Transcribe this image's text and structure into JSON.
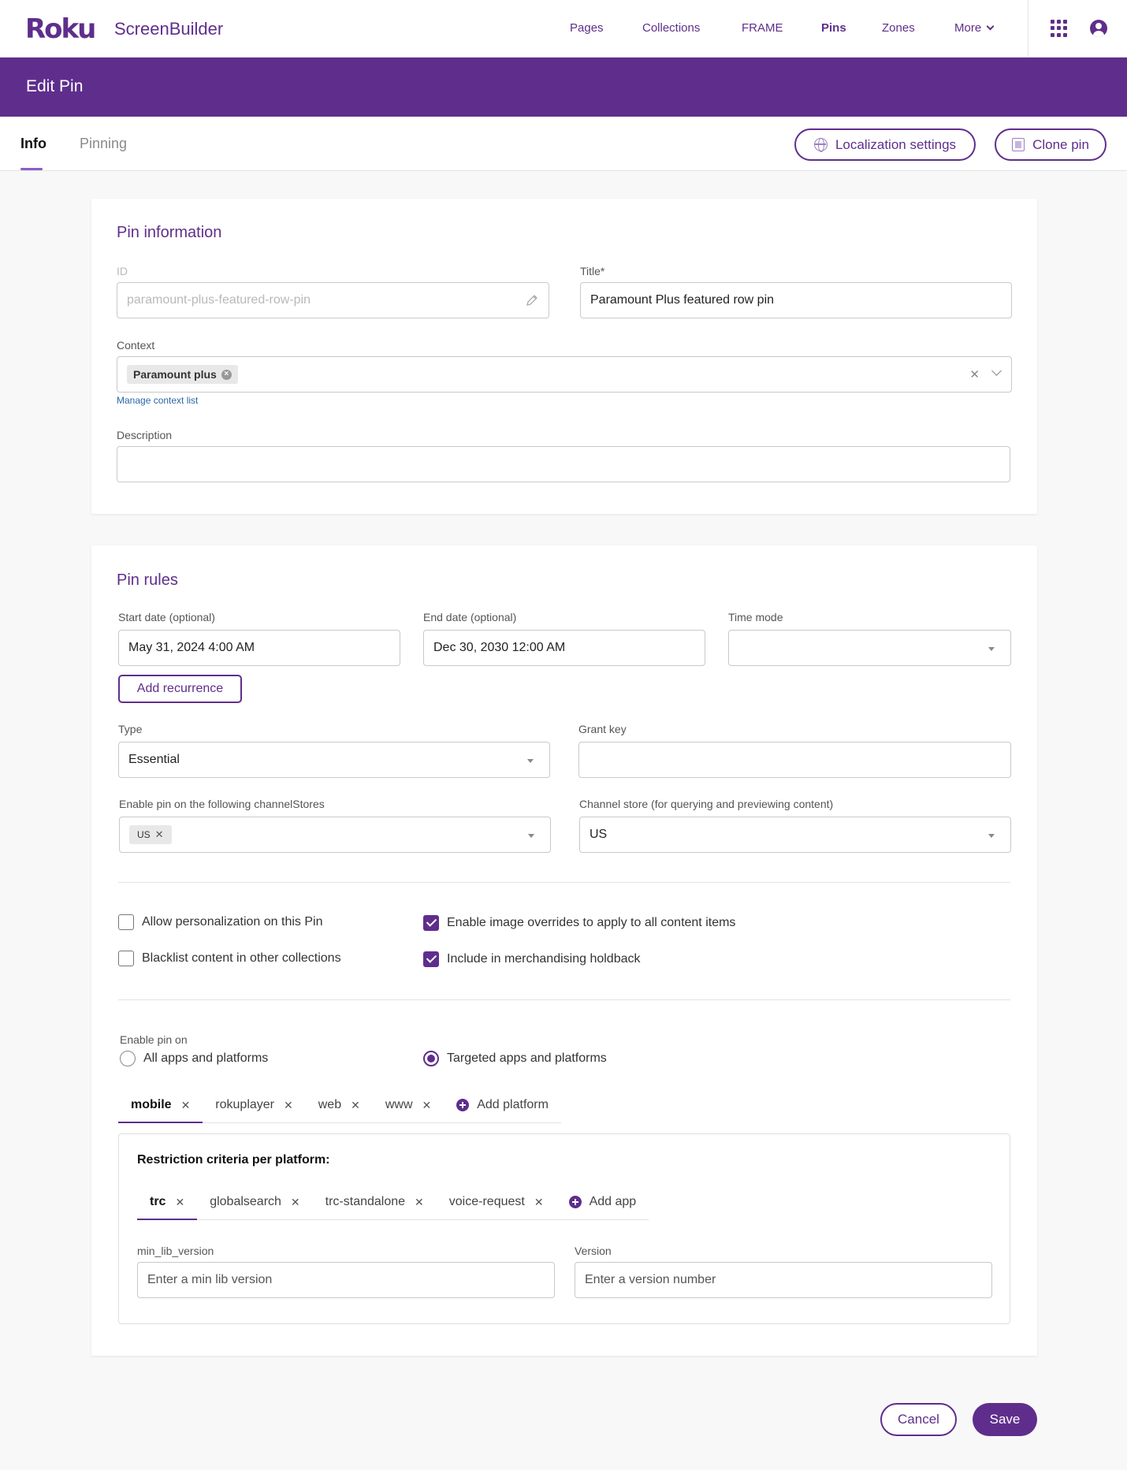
{
  "app": {
    "brand": "Roku",
    "name": "ScreenBuilder"
  },
  "nav": {
    "pages": "Pages",
    "collections": "Collections",
    "frame": "FRAME",
    "pins": "Pins",
    "zones": "Zones",
    "more": "More"
  },
  "header": {
    "title": "Edit Pin"
  },
  "tabs": {
    "info": "Info",
    "pinning": "Pinning"
  },
  "actions": {
    "localization": "Localization settings",
    "clone": "Clone pin"
  },
  "pin_info": {
    "title": "Pin information",
    "id_label": "ID",
    "id_value": "paramount-plus-featured-row-pin",
    "title_label": "Title*",
    "title_value": "Paramount Plus featured row pin",
    "context_label": "Context",
    "context_chip": "Paramount plus",
    "manage_context": "Manage context list",
    "description_label": "Description",
    "description_value": ""
  },
  "pin_rules": {
    "title": "Pin rules",
    "start_label": "Start date (optional)",
    "start_value": "May 31, 2024 4:00 AM",
    "end_label": "End date (optional)",
    "end_value": "Dec 30, 2030 12:00 AM",
    "time_mode_label": "Time mode",
    "time_mode_value": "",
    "add_recurrence": "Add recurrence",
    "type_label": "Type",
    "type_value": "Essential",
    "grant_key_label": "Grant key",
    "grant_key_value": "",
    "channelstores_label": "Enable pin on the following channelStores",
    "channelstores_chip": "US",
    "channel_store_label": "Channel store (for querying and previewing content)",
    "channel_store_value": "US",
    "cb_personalization": "Allow personalization on this Pin",
    "cb_blacklist": "Blacklist content in other collections",
    "cb_image_overrides": "Enable image overrides to apply to all content items",
    "cb_holdback": "Include in merchandising holdback",
    "enable_on_label": "Enable pin on",
    "radio_all": "All apps and platforms",
    "radio_targeted": "Targeted apps and platforms",
    "platforms": [
      "mobile",
      "rokuplayer",
      "web",
      "www"
    ],
    "add_platform": "Add platform",
    "restriction_title": "Restriction criteria per platform:",
    "apps": [
      "trc",
      "globalsearch",
      "trc-standalone",
      "voice-request"
    ],
    "add_app": "Add app",
    "min_lib_label": "min_lib_version",
    "min_lib_placeholder": "Enter a min lib version",
    "version_label": "Version",
    "version_placeholder": "Enter a version number"
  },
  "footer": {
    "cancel": "Cancel",
    "save": "Save"
  },
  "colors": {
    "brand": "#5f2e8c",
    "accent_underline": "#8b5cc6"
  }
}
